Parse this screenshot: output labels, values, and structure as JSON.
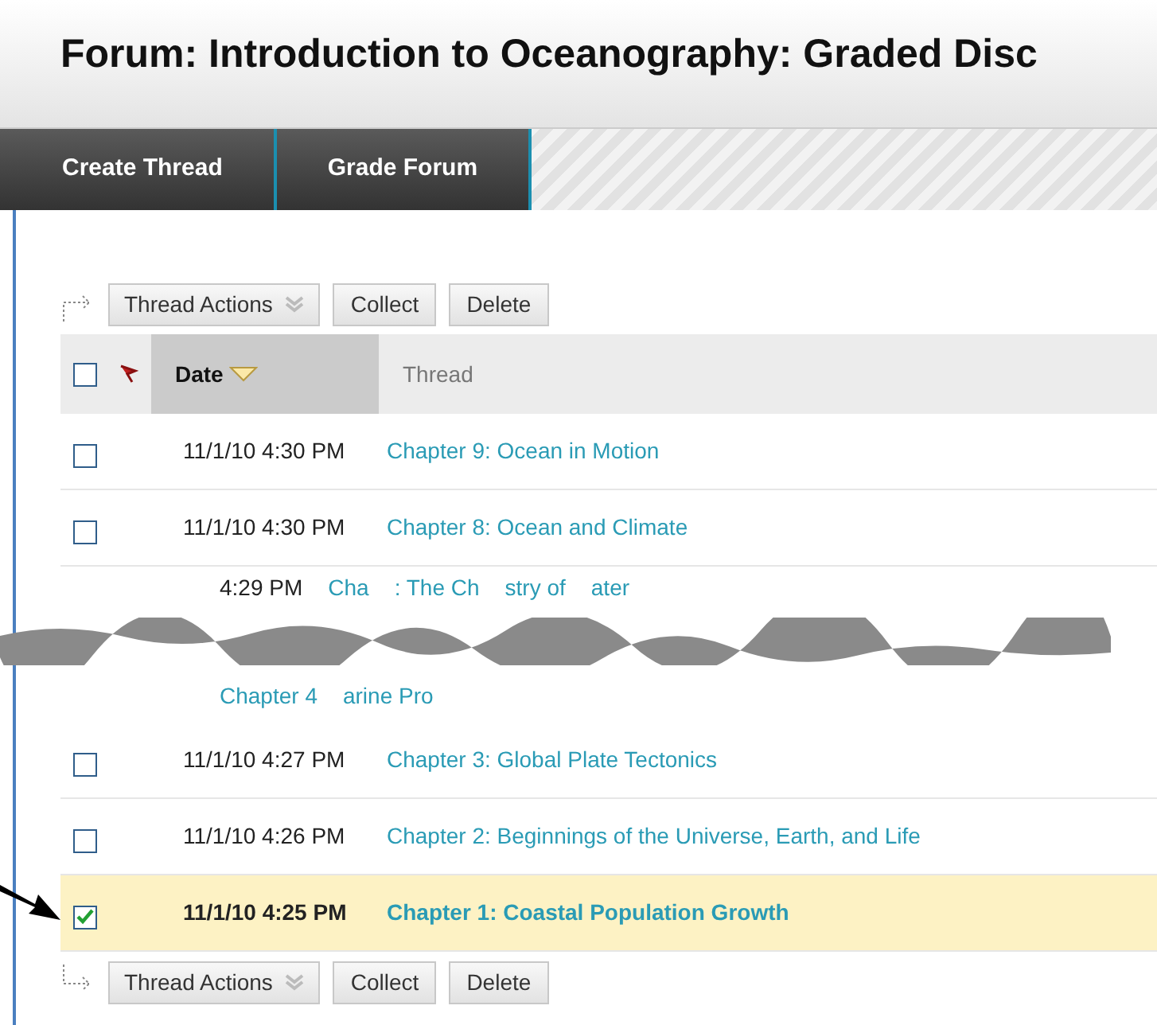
{
  "page_title": "Forum: Introduction to Oceanography: Graded Disc",
  "tabs": [
    {
      "label": "Create Thread"
    },
    {
      "label": "Grade Forum"
    }
  ],
  "top_actions": {
    "menu": "Thread Actions",
    "buttons": [
      "Collect",
      "Delete"
    ]
  },
  "table": {
    "select_all": {
      "checked": false
    },
    "columns": [
      {
        "label": "Date",
        "sorted": true
      },
      {
        "label": "Thread",
        "sorted": false
      }
    ],
    "rows_before": [
      {
        "date": "11/1/10 4:30 PM",
        "thread": "Chapter 9: Ocean in Motion",
        "selected": false
      },
      {
        "date": "11/1/10 4:30 PM",
        "thread": "Chapter 8: Ocean and Climate",
        "selected": false
      }
    ],
    "torn_rows": [
      {
        "date": "4:29 PM",
        "thread_fragments": [
          "Cha",
          ": The Ch",
          "stry of",
          "ater"
        ]
      },
      {
        "thread_fragments": [
          "Chapter 4",
          "arine Pro"
        ]
      }
    ],
    "rows_after": [
      {
        "date": "11/1/10 4:27 PM",
        "thread": "Chapter 3: Global Plate Tectonics",
        "selected": false
      },
      {
        "date": "11/1/10 4:26 PM",
        "thread": "Chapter 2: Beginnings of the Universe, Earth, and Life",
        "selected": false
      },
      {
        "date": "11/1/10 4:25 PM",
        "thread": "Chapter 1: Coastal Population Growth",
        "selected": true
      }
    ]
  },
  "bottom_actions": {
    "menu": "Thread Actions",
    "buttons": [
      "Collect",
      "Delete"
    ]
  }
}
